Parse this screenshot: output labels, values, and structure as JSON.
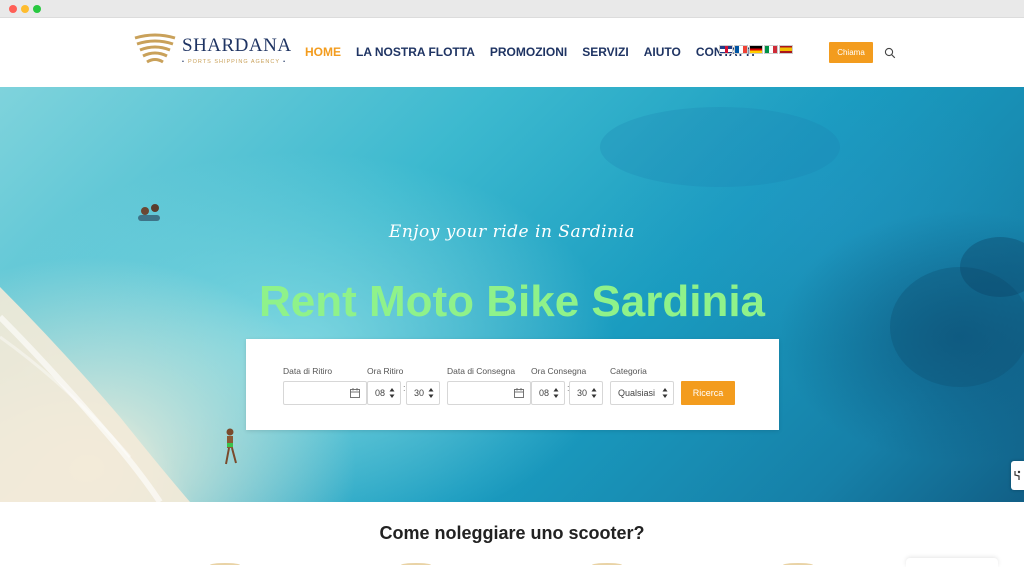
{
  "brand": {
    "name": "SHARDANA",
    "subtitle": "PORTS SHIPPING AGENCY"
  },
  "nav": {
    "items": [
      {
        "label": "HOME",
        "active": true
      },
      {
        "label": "LA NOSTRA FLOTTA",
        "active": false
      },
      {
        "label": "PROMOZIONI",
        "active": false
      },
      {
        "label": "SERVIZI",
        "active": false
      },
      {
        "label": "AIUTO",
        "active": false
      },
      {
        "label": "CONTATTI",
        "active": false
      }
    ],
    "languages": [
      "flag-gb-icon",
      "flag-fr-icon",
      "flag-de-icon",
      "flag-it-icon",
      "flag-es-icon"
    ],
    "call_label": "Chiama",
    "search_icon": "search-icon"
  },
  "hero": {
    "tagline": "Enjoy your ride in Sardinia",
    "title": "Rent Moto Bike Sardinia"
  },
  "booking": {
    "pickup_date_label": "Data di Ritiro",
    "pickup_date_value": "",
    "pickup_time_label": "Ora Ritiro",
    "pickup_hour": "08",
    "pickup_minute": "30",
    "return_date_label": "Data di Consegna",
    "return_date_value": "",
    "return_time_label": "Ora Consegna",
    "return_hour": "08",
    "return_minute": "30",
    "category_label": "Categoria",
    "category_value": "Qualsiasi",
    "search_label": "Ricerca"
  },
  "section": {
    "title": "Come noleggiare uno scooter?"
  },
  "colors": {
    "accent": "#f39c1e",
    "navy": "#1f3463",
    "title_green": "#8ff28a"
  }
}
